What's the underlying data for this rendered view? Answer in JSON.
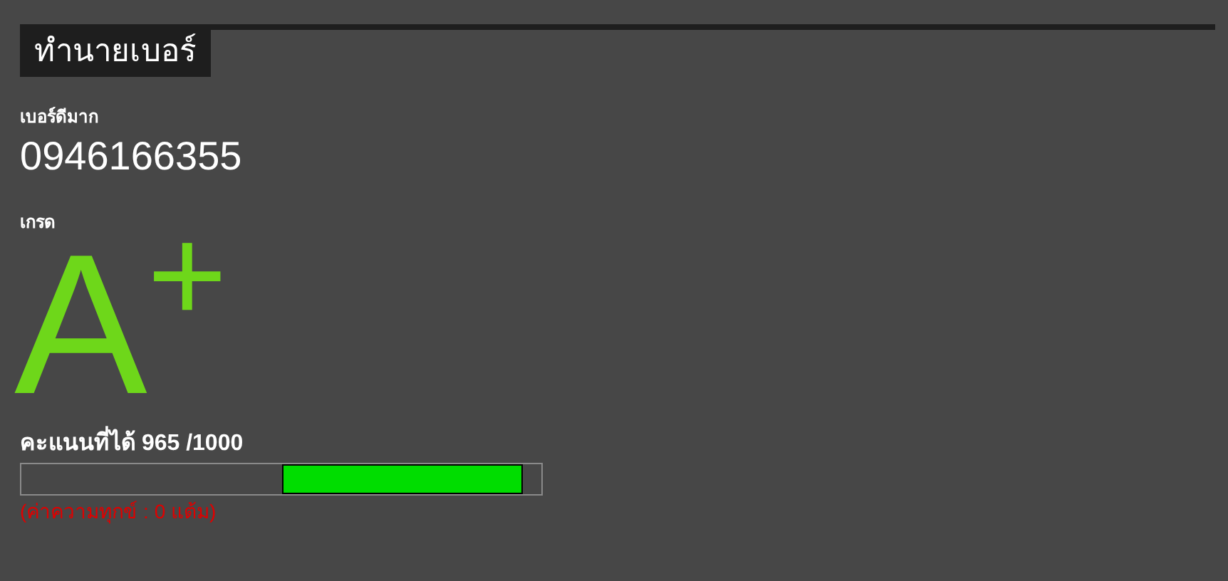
{
  "section_title": "ทำนายเบอร์",
  "number_label": "เบอร์ดีมาก",
  "number": "0946166355",
  "grade_label": "เกรด",
  "grade": {
    "letter": "A",
    "modifier": "+"
  },
  "score": {
    "label": "คะแนนที่ได้ 965 /1000",
    "level": 0.965,
    "note": "(ค่าความทุกข์ : 0 แต้ม)"
  }
}
